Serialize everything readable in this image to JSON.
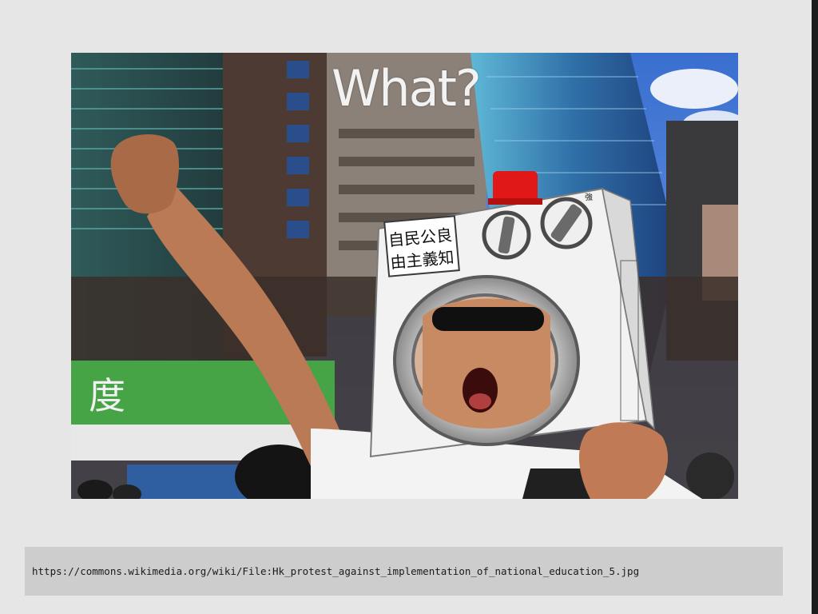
{
  "slide": {
    "title": "What?",
    "source_url": "https://commons.wikimedia.org/wiki/File:Hk_protest_against_implementation_of_national_education_5.jpg"
  },
  "photo": {
    "sign_characters": [
      "自民公良",
      "由主義知"
    ],
    "shop_sign_character": "度",
    "corner_character": "強"
  },
  "colors": {
    "background": "#e6e6e6",
    "url_bar": "#cdcdcd",
    "title_text": "#f2f2f2"
  }
}
